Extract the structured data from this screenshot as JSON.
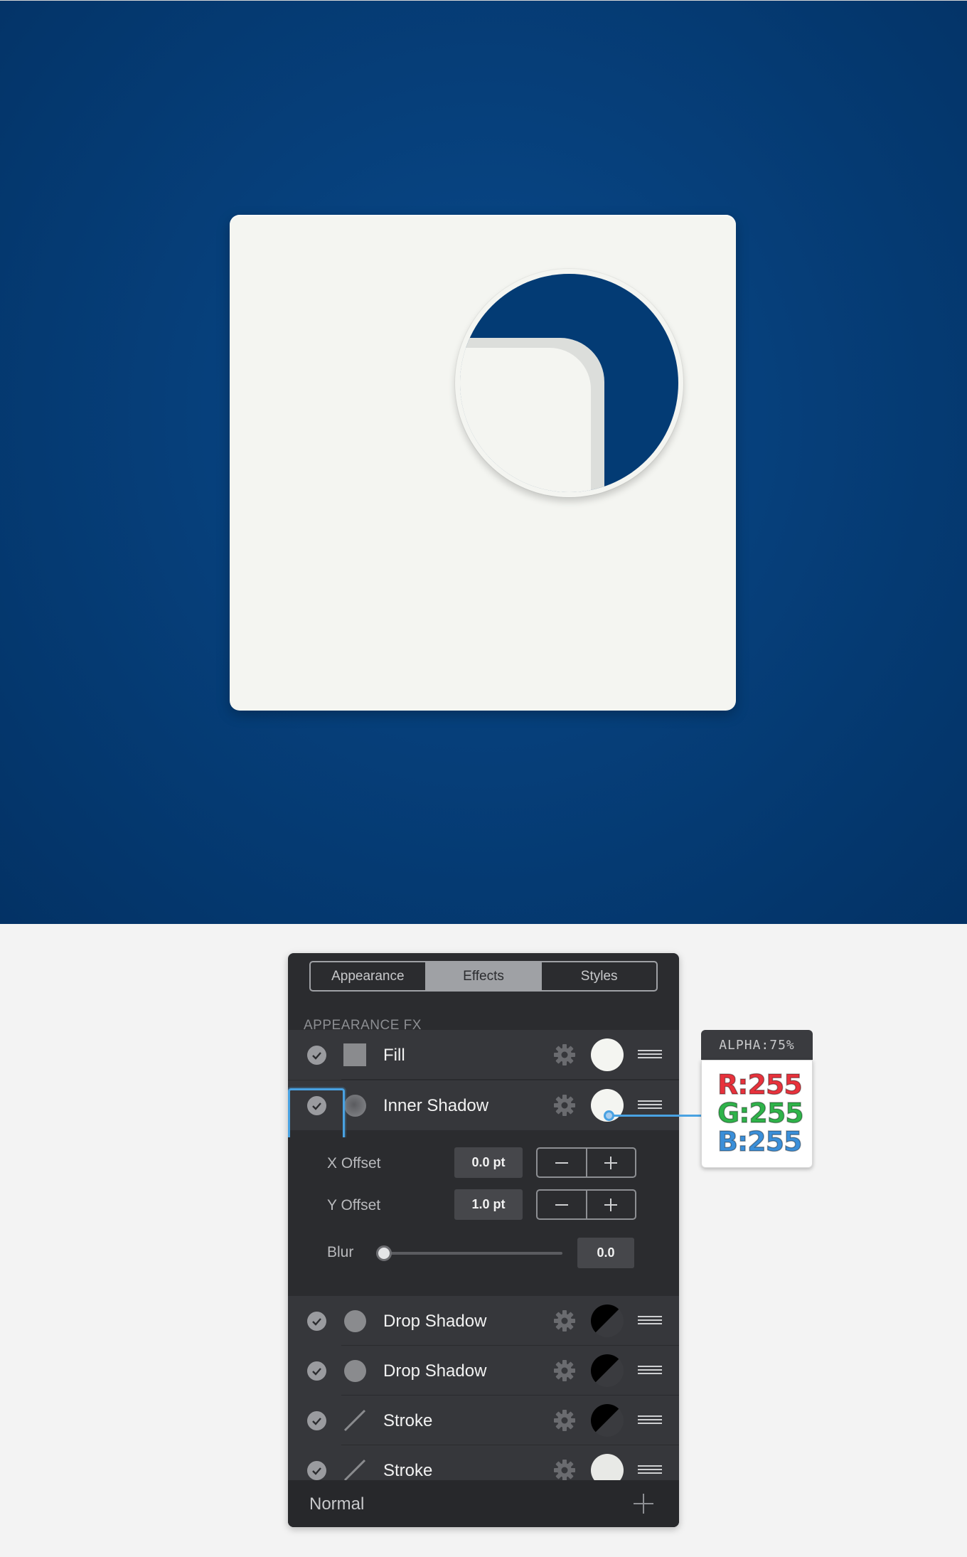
{
  "panel": {
    "tabs": [
      "Appearance",
      "Effects",
      "Styles"
    ],
    "active_tab": "Effects",
    "section_title": "APPEARANCE FX",
    "rows": [
      {
        "label": "Fill",
        "swatch": "square-swatch-icon",
        "color": "#f4f5f1"
      },
      {
        "label": "Inner Shadow",
        "swatch": "soft-circle-swatch-icon",
        "color": "#ffffff"
      },
      {
        "label": "Drop Shadow",
        "swatch": "circle-swatch-icon",
        "color": "#000000"
      },
      {
        "label": "Drop Shadow",
        "swatch": "circle-swatch-icon",
        "color": "#000000"
      },
      {
        "label": "Stroke",
        "swatch": "line-swatch-icon",
        "color": "#000000"
      },
      {
        "label": "Stroke",
        "swatch": "line-swatch-icon",
        "color": "#f4f5f1"
      }
    ],
    "inner_shadow": {
      "x_offset_label": "X Offset",
      "x_offset_value": "0.0 pt",
      "y_offset_label": "Y Offset",
      "y_offset_value": "1.0 pt",
      "blur_label": "Blur",
      "blur_value": "0.0"
    },
    "blend_mode": "Normal"
  },
  "color_callout": {
    "alpha": "ALPHA:75%",
    "r": "R:255",
    "g": "G:255",
    "b": "B:255"
  },
  "colors": {
    "canvas_blue": "#063f7a",
    "card_white": "#f4f5f1",
    "panel_dark": "#2b2c2f",
    "selection_blue": "#49a2e2",
    "red": "#e8323c",
    "green": "#2fb34a",
    "blue": "#3b8fd9"
  }
}
